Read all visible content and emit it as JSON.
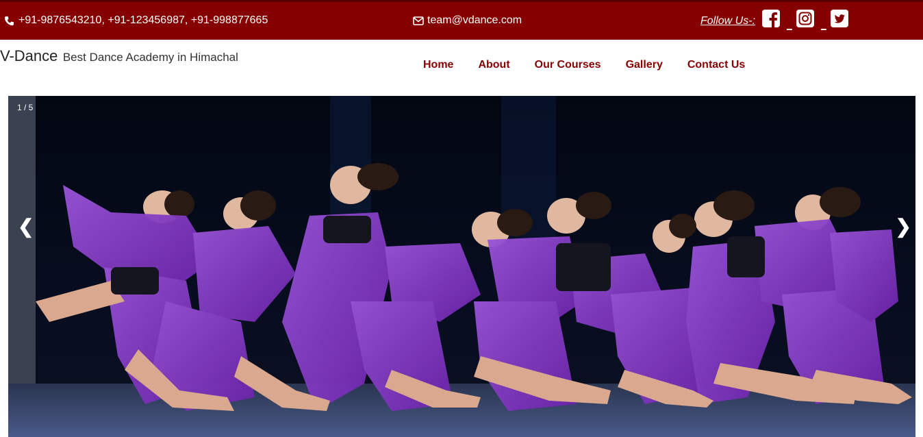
{
  "topbar": {
    "phones": "+91-9876543210,  +91-123456987, +91-998877665",
    "email": "team@vdance.com",
    "follow_label": "Follow Us-:",
    "social_icons": [
      "facebook-icon",
      "instagram-icon",
      "twitter-icon"
    ],
    "background": "#850000"
  },
  "brand": {
    "name": "V-Dance",
    "tagline": "Best Dance Academy in Himachal"
  },
  "nav": {
    "items": [
      "Home",
      "About",
      "Our Courses",
      "Gallery",
      "Contact Us"
    ],
    "color": "#850000"
  },
  "slider": {
    "counter": "1 / 5",
    "prev_icon": "❮",
    "next_icon": "❯",
    "costume_color": "#8a3fc4"
  }
}
